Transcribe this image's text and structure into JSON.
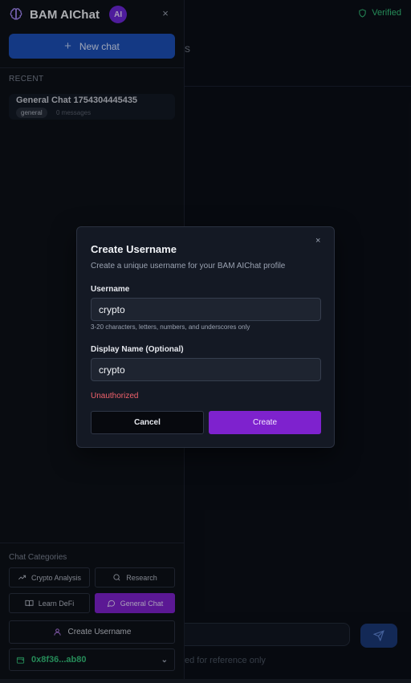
{
  "main": {
    "verified_label": "Verified",
    "peek_text": "s",
    "footnote": "ed for reference only",
    "status_color": "#34c07a"
  },
  "sidebar": {
    "app_title": "BAM AIChat",
    "ai_badge": "AI",
    "close_icon": "×",
    "new_chat_label": "New chat",
    "recent_label": "RECENT",
    "chats": [
      {
        "title": "General Chat 1754304445435",
        "tag": "general",
        "messages": "0 messages"
      }
    ],
    "categories_label": "Chat Categories",
    "categories": [
      {
        "label": "Crypto Analysis",
        "icon": "trending-up-icon",
        "active": false
      },
      {
        "label": "Research",
        "icon": "search-icon",
        "active": false
      },
      {
        "label": "Learn DeFi",
        "icon": "book-icon",
        "active": false
      },
      {
        "label": "General Chat",
        "icon": "chat-bubble-icon",
        "active": true
      }
    ],
    "create_username_label": "Create Username",
    "wallet_address": "0x8f36...ab80",
    "accent_color": "#1d4fb8",
    "active_category_color": "#7e22ce"
  },
  "dialog": {
    "title": "Create Username",
    "description": "Create a unique username for your BAM AIChat profile",
    "username_label": "Username",
    "username_value": "crypto",
    "username_hint": "3-20 characters, letters, numbers, and underscores only",
    "display_name_label": "Display Name (Optional)",
    "display_name_value": "crypto",
    "error_text": "Unauthorized",
    "cancel_label": "Cancel",
    "create_label": "Create",
    "close_icon": "×",
    "error_color": "#f0616b"
  }
}
